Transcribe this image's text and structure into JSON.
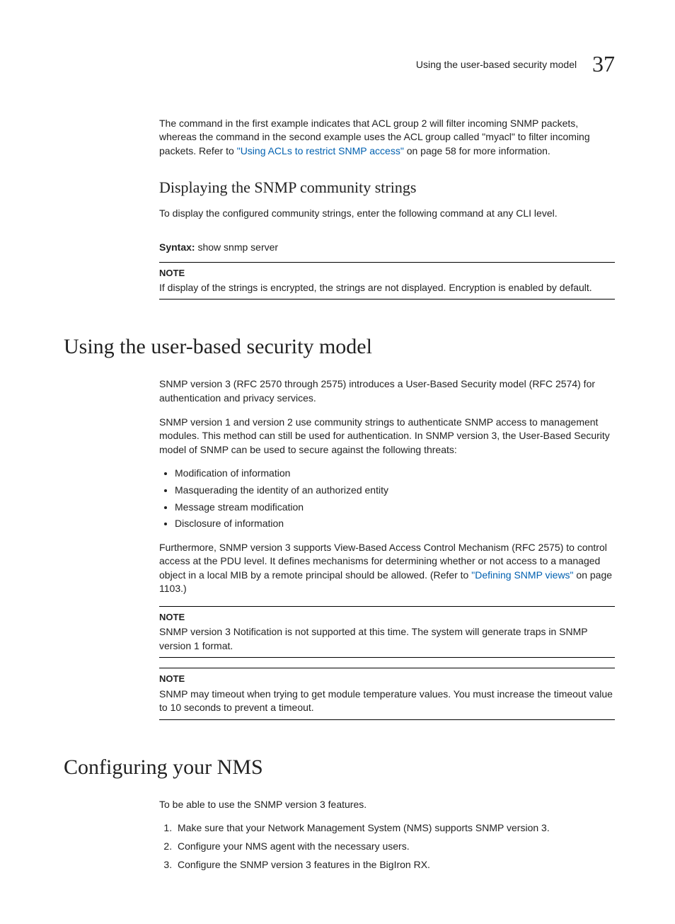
{
  "header": {
    "title": "Using the user-based security model",
    "chapter_number": "37"
  },
  "intro": {
    "p1_prefix": "The command in the first example indicates that ACL group 2 will filter incoming SNMP packets, whereas the command in the second example uses the ACL group called \"myacl\" to filter incoming packets. Refer to ",
    "p1_link": "\"Using ACLs to restrict SNMP access\"",
    "p1_suffix": " on page 58 for more information."
  },
  "section_display": {
    "heading": "Displaying the SNMP community strings",
    "p1": "To display the configured community strings, enter the following command at any CLI level.",
    "syntax_label": "Syntax:",
    "syntax_text": "show snmp server",
    "note_label": "NOTE",
    "note_text": "If display of the strings is encrypted, the strings are not displayed.  Encryption is enabled by default."
  },
  "section_usm": {
    "heading": "Using the user-based security model",
    "p1": "SNMP version 3 (RFC 2570 through 2575) introduces a User-Based Security model (RFC 2574) for authentication and privacy services.",
    "p2": "SNMP version 1 and version 2 use community strings to authenticate SNMP access to management modules. This method can still be used for authentication.  In SNMP version 3, the User-Based Security model of SNMP can be used to secure against the following threats:",
    "bullets": {
      "b0": "Modification of information",
      "b1": "Masquerading the identity of an authorized entity",
      "b2": "Message stream modification",
      "b3": "Disclosure of information"
    },
    "p3_prefix": "Furthermore, SNMP version 3 supports View-Based Access Control Mechanism (RFC 2575) to control access at the PDU level. It defines mechanisms for determining whether or not access to a managed object in a local MIB by a remote principal should be allowed. (Refer to ",
    "p3_link": "\"Defining SNMP views\"",
    "p3_suffix": " on page 1103.)",
    "note1_label": "NOTE",
    "note1_text": "SNMP version 3 Notification is not supported at this time. The system will generate traps in SNMP version 1 format.",
    "note2_label": "NOTE",
    "note2_text": "SNMP may timeout when trying to get module temperature values. You must increase the timeout value to 10 seconds to prevent a timeout."
  },
  "section_nms": {
    "heading": "Configuring your NMS",
    "p1": "To be able to use the SNMP version 3 features.",
    "steps": {
      "s0": "Make sure that your Network Management System (NMS) supports SNMP version 3.",
      "s1": "Configure your NMS agent with the necessary users.",
      "s2": "Configure the SNMP version 3 features in the BigIron RX."
    }
  }
}
